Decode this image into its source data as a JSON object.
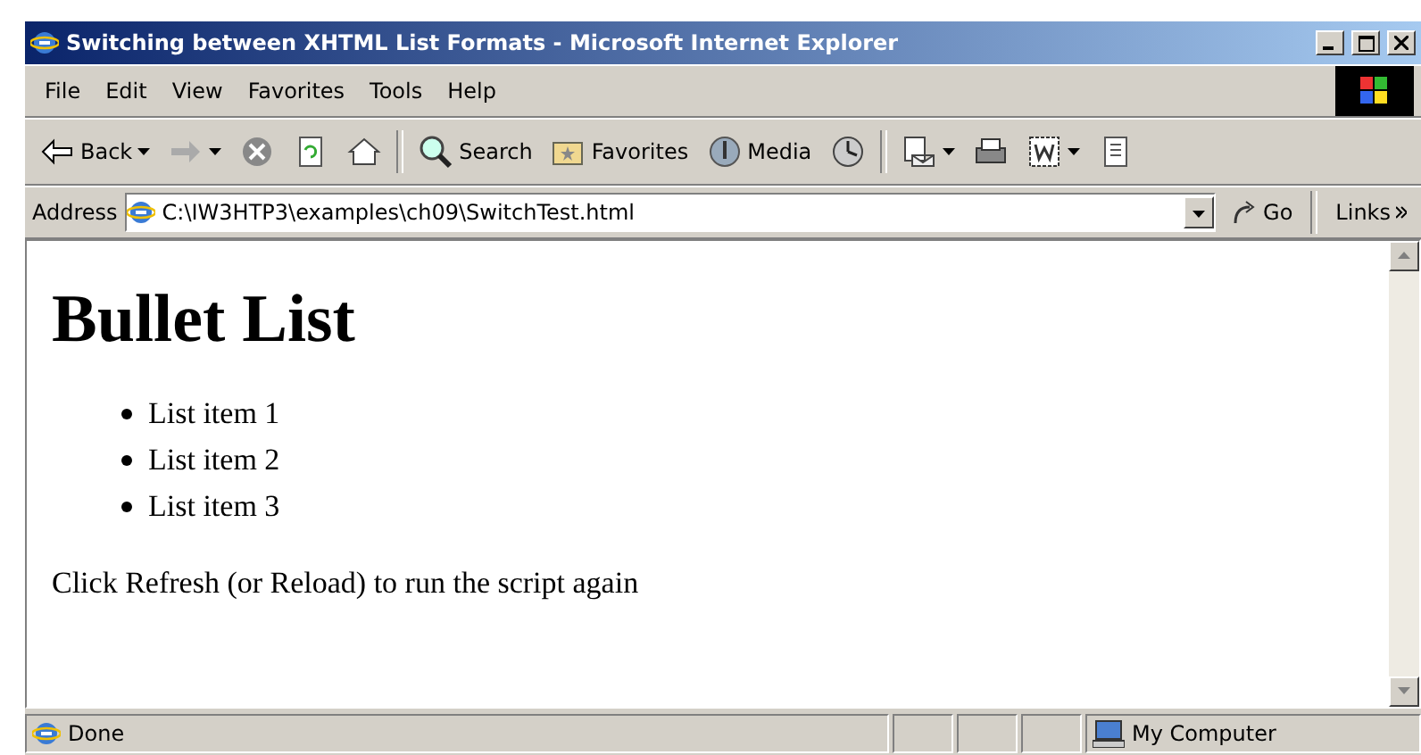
{
  "window": {
    "title": "Switching between XHTML List Formats - Microsoft Internet Explorer"
  },
  "menu": [
    "File",
    "Edit",
    "View",
    "Favorites",
    "Tools",
    "Help"
  ],
  "toolbar": [
    {
      "kind": "back",
      "label": "Back",
      "dropdown": true
    },
    {
      "kind": "forward",
      "dropdown": true
    },
    {
      "kind": "stop"
    },
    {
      "kind": "refresh"
    },
    {
      "kind": "home"
    },
    {
      "kind": "separator"
    },
    {
      "kind": "search",
      "label": "Search"
    },
    {
      "kind": "favorites",
      "label": "Favorites"
    },
    {
      "kind": "media",
      "label": "Media"
    },
    {
      "kind": "history"
    },
    {
      "kind": "separator"
    },
    {
      "kind": "mail",
      "dropdown": true
    },
    {
      "kind": "print"
    },
    {
      "kind": "edit",
      "dropdown": true
    },
    {
      "kind": "discuss"
    }
  ],
  "address": {
    "label": "Address",
    "value": "C:\\IW3HTP3\\examples\\ch09\\SwitchTest.html",
    "go": "Go",
    "links": "Links"
  },
  "page": {
    "heading": "Bullet List",
    "items": [
      "List item 1",
      "List item 2",
      "List item 3"
    ],
    "footer": "Click Refresh (or Reload) to run the script again"
  },
  "status_bar": {
    "text": "Done",
    "zone": "My Computer"
  }
}
